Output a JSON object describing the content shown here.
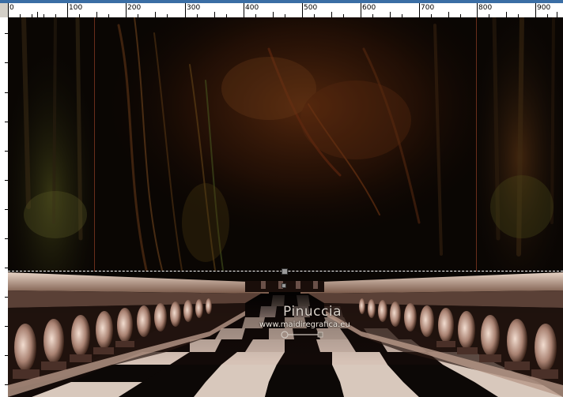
{
  "ruler": {
    "labels": [
      "0",
      "100",
      "200",
      "300",
      "400",
      "500",
      "600",
      "700",
      "800",
      "900"
    ]
  },
  "canvas": {
    "watermark_title": "Pinuccia",
    "watermark_url": "www.maidiregrafica.eu"
  },
  "colors": {
    "guide_line": "#7a3520",
    "selection_marquee": "#ffffff",
    "ruler_bg": "#ffffff",
    "window_bg": "#d4d0c8"
  }
}
